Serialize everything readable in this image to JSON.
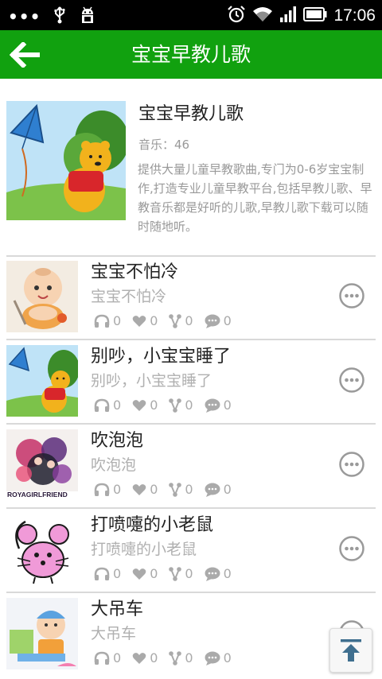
{
  "status_bar": {
    "time": "17:06",
    "left_icons": [
      "notification-dots-icon",
      "usb-icon",
      "android-debug-icon"
    ],
    "right_icons": [
      "alarm-icon",
      "wifi-icon",
      "signal-icon",
      "battery-icon"
    ]
  },
  "header": {
    "title": "宝宝早教儿歌",
    "back_icon": "arrow-left-icon"
  },
  "album": {
    "name": "宝宝早教儿歌",
    "count_text": "音乐：46",
    "description": "提供大量儿童早教歌曲,专门为0-6岁宝宝制作,打造专业儿童早教平台,包括早教儿歌、早教音乐都是好听的儿歌,早教儿歌下载可以随时随地听。"
  },
  "songs": [
    {
      "title": "宝宝不怕冷",
      "subtitle": "宝宝不怕冷",
      "listens": "0",
      "likes": "0",
      "shares": "0",
      "comments": "0"
    },
    {
      "title": "别吵，小宝宝睡了",
      "subtitle": "别吵，小宝宝睡了",
      "listens": "0",
      "likes": "0",
      "shares": "0",
      "comments": "0"
    },
    {
      "title": "吹泡泡",
      "subtitle": "吹泡泡",
      "listens": "0",
      "likes": "0",
      "shares": "0",
      "comments": "0",
      "cover_caption": "ROYAGIRLFRIEND"
    },
    {
      "title": "打喷嚏的小老鼠",
      "subtitle": "打喷嚏的小老鼠",
      "listens": "0",
      "likes": "0",
      "shares": "0",
      "comments": "0"
    },
    {
      "title": "大吊车",
      "subtitle": "大吊车",
      "listens": "0",
      "likes": "0",
      "shares": "0",
      "comments": "0"
    }
  ],
  "colors": {
    "header_bg": "#11a10f",
    "status_bar_bg": "#000000",
    "divider": "#d9d9d9",
    "subtext": "#b0b0b0"
  }
}
